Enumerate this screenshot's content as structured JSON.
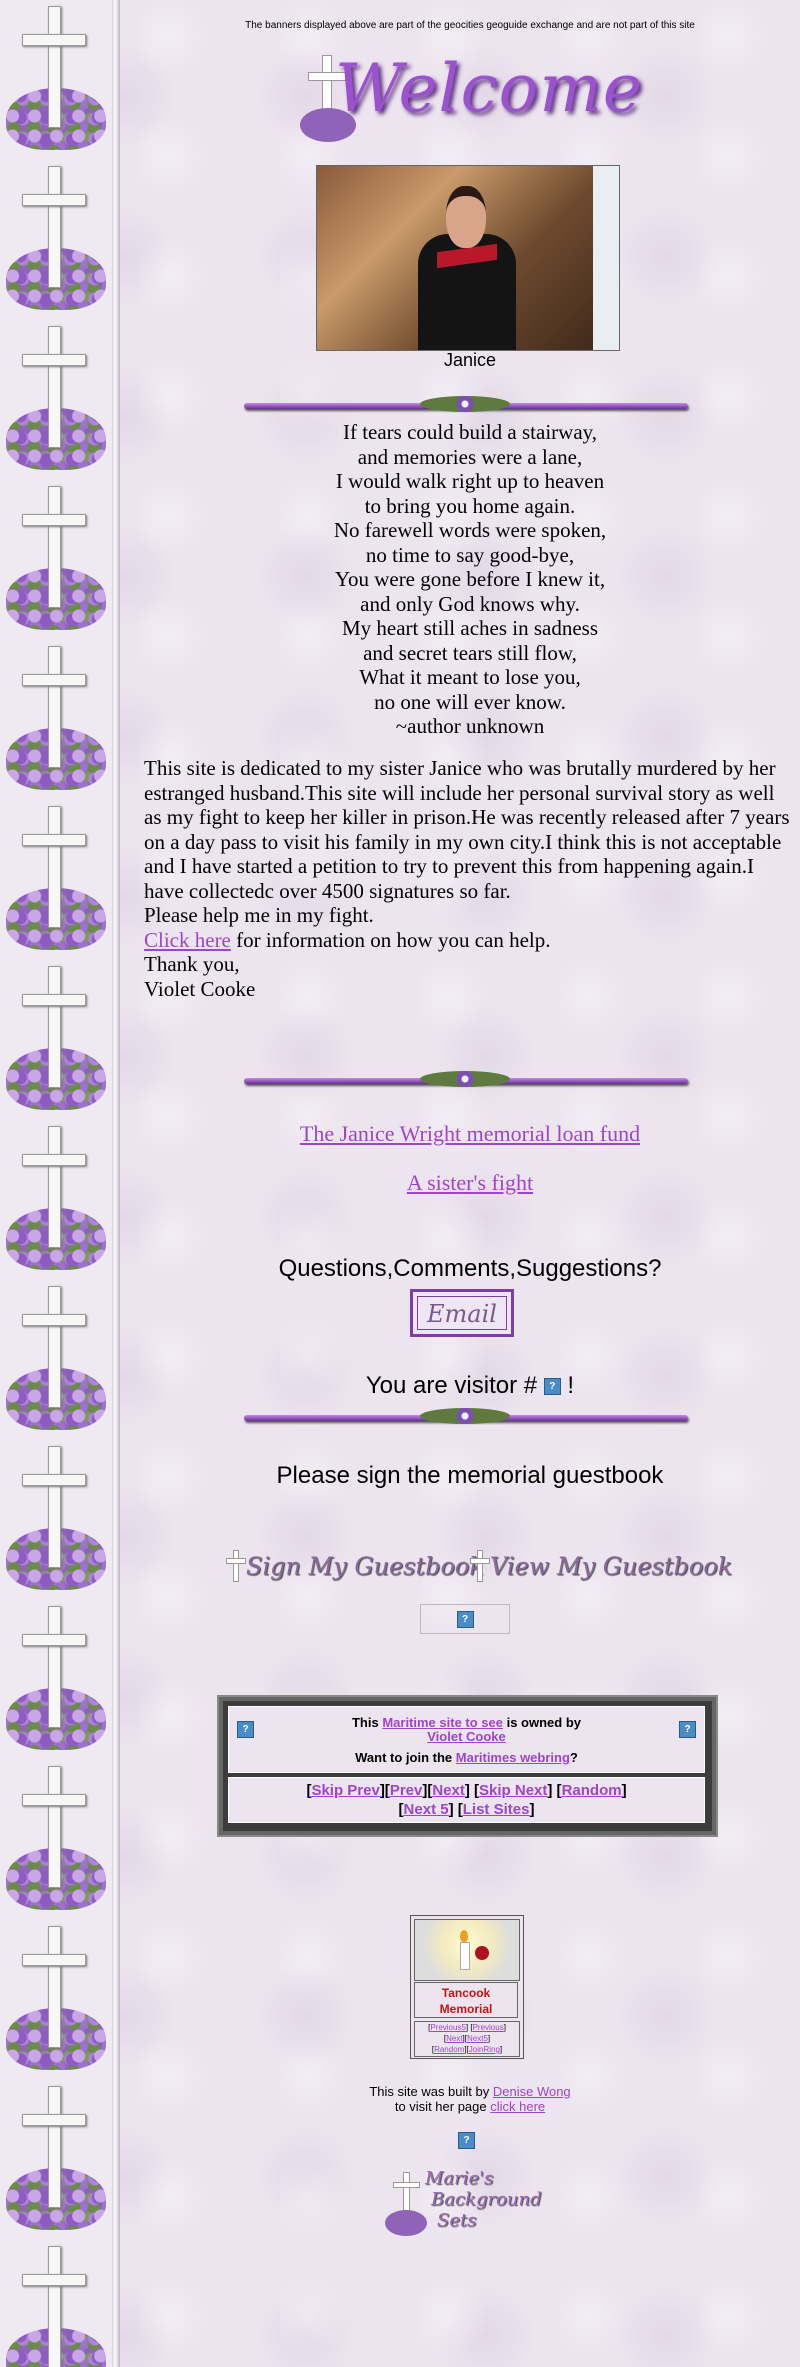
{
  "banner_note": "The banners displayed above are part of the geocities geoguide exchange and are not part of this site",
  "welcome_title": "Welcome",
  "photo_caption": "Janice",
  "poem": [
    "If tears could build a stairway,",
    "and memories were a lane,",
    "I would walk right up to heaven",
    "to bring you home again.",
    "No farewell words were spoken,",
    "no time to say good-bye,",
    "You were gone before I knew it,",
    "and only God knows why.",
    "My heart still aches in sadness",
    "and secret tears still flow,",
    "What it meant to lose you,",
    "no one will ever know.",
    "~author unknown"
  ],
  "dedication": {
    "paragraph": "This site is dedicated to my sister Janice who was brutally murdered by her estranged husband.This site will include her personal survival story as well as my fight to keep her killer in prison.He was recently released after 7 years on a day pass to visit his family in my own city.I think this is not acceptable and I have started a petition to try to prevent this from happening again.I have collectedc over 4500 signatures so far.",
    "help_line": "Please help me in my fight.",
    "click_link": "Click here",
    "click_suffix": " for information on how you can help.",
    "thanks": "Thank you,",
    "signature": "Violet Cooke"
  },
  "links": {
    "loan_fund": "The Janice Wright memorial loan fund",
    "sisters_fight": "A sister's fight"
  },
  "contact": {
    "question": "Questions,Comments,Suggestions?",
    "email_button": "Email"
  },
  "visitor": {
    "prefix": "You are visitor # ",
    "suffix": " !"
  },
  "guestbook": {
    "prompt": "Please sign the memorial guestbook",
    "sign": "Sign My Guestbook",
    "view": "View My Guestbook"
  },
  "webring": {
    "this_text": "This ",
    "site_link": "Maritime site to see",
    "owned_by": " is owned by",
    "owner": "Violet Cooke",
    "join_prefix": "Want to join the ",
    "ring_link": "Maritimes webring",
    "join_suffix": "?",
    "nav": [
      "Skip Prev",
      "Prev",
      "Next",
      "Skip Next",
      "Random",
      "Next 5",
      "List Sites"
    ]
  },
  "tancook": {
    "title_line1": "Tancook",
    "title_line2": "Memorial",
    "nav": [
      "Previous5",
      "Previous",
      "Next",
      "Next5",
      "Random",
      "JoinRing"
    ]
  },
  "footer": {
    "built_prefix": "This site was built by ",
    "builder": "Denise Wong",
    "visit_prefix": "to visit her page ",
    "visit_link": "click here",
    "marie_line1": "Marie's",
    "marie_line2": "Background",
    "marie_line3": "Sets"
  },
  "colors": {
    "link": "#a044c8",
    "accent_purple": "#9a52cf",
    "tancook_red": "#d01010"
  },
  "icons": {
    "counter": "question-mark-icon"
  }
}
